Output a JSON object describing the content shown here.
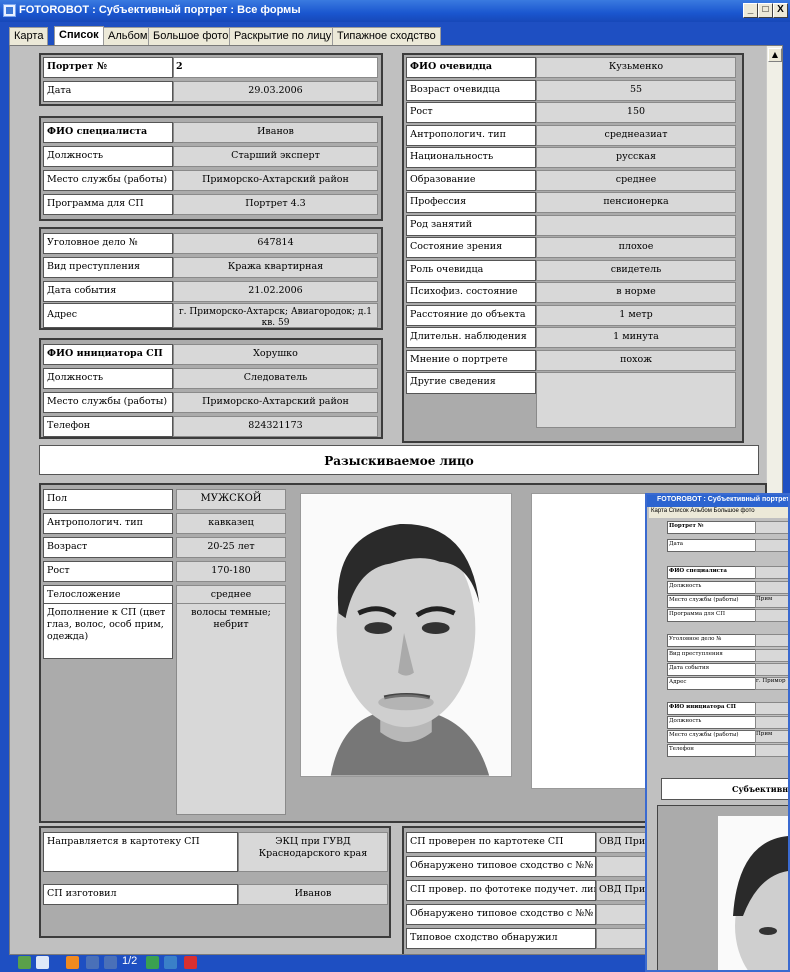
{
  "window": {
    "title": "FOTOROBOT : Субъективный портрет : Все формы",
    "minimize": "_",
    "maximize": "□",
    "close": "X"
  },
  "tabs": [
    "Карта",
    "Список",
    "Альбом",
    "Большое фото",
    "Раскрытие по лицу",
    "Типажное сходство"
  ],
  "portrait": {
    "number_label": "Портрет №",
    "number": "2",
    "date_label": "Дата",
    "date": "29.03.2006"
  },
  "specialist": [
    {
      "label": "ФИО специалиста",
      "value": "Иванов",
      "bold": true
    },
    {
      "label": "Должность",
      "value": "Старший эксперт"
    },
    {
      "label": "Место службы (работы)",
      "value": "Приморско-Ахтарский район"
    },
    {
      "label": "Программа для СП",
      "value": "Портрет 4.3"
    }
  ],
  "case": [
    {
      "label": "Уголовное дело №",
      "value": "647814"
    },
    {
      "label": "Вид преступления",
      "value": "Кража квартирная"
    },
    {
      "label": "Дата события",
      "value": "21.02.2006"
    },
    {
      "label": "Адрес",
      "value": "г. Приморско-Ахтарск; Авиагородок; д.1 кв. 59"
    }
  ],
  "initiator": [
    {
      "label": "ФИО инициатора СП",
      "value": "Хорушко",
      "bold": true
    },
    {
      "label": "Должность",
      "value": "Следователь"
    },
    {
      "label": "Место службы (работы)",
      "value": "Приморско-Ахтарский район"
    },
    {
      "label": "Телефон",
      "value": "824321173"
    }
  ],
  "witness": [
    {
      "label": "ФИО очевидца",
      "value": "Кузьменко",
      "bold": true
    },
    {
      "label": "Возраст очевидца",
      "value": "55"
    },
    {
      "label": "Рост",
      "value": "150"
    },
    {
      "label": "Антропологич. тип",
      "value": "среднеазиат"
    },
    {
      "label": "Национальность",
      "value": "русская"
    },
    {
      "label": "Образование",
      "value": "среднее"
    },
    {
      "label": "Профессия",
      "value": "пенсионерка"
    },
    {
      "label": "Род занятий",
      "value": ""
    },
    {
      "label": "Состояние зрения",
      "value": "плохое"
    },
    {
      "label": "Роль очевидца",
      "value": "свидетель"
    },
    {
      "label": "Психофиз. состояние",
      "value": "в норме"
    },
    {
      "label": "Расстояние до объекта",
      "value": "1 метр"
    },
    {
      "label": "Длительн. наблюдения",
      "value": "1 минута"
    },
    {
      "label": "Мнение о портрете",
      "value": "похож"
    },
    {
      "label": "Другие сведения",
      "value": ""
    }
  ],
  "section_title": "Разыскиваемое лицо",
  "suspect": [
    {
      "label": "Пол",
      "value": "МУЖСКОЙ"
    },
    {
      "label": "Антропологич. тип",
      "value": "кавказец"
    },
    {
      "label": "Возраст",
      "value": "20-25 лет"
    },
    {
      "label": "Рост",
      "value": "170-180"
    },
    {
      "label": "Телосложение",
      "value": "среднее"
    },
    {
      "label": "Дополнение к СП (цвет глаз, волос, особ прим, одежда)",
      "value": "волосы темные; небрит"
    }
  ],
  "routing": [
    {
      "label": "Направляется в картотеку СП",
      "value": "ЭКЦ при ГУВД Краснодарского края"
    },
    {
      "label": "СП изготовил",
      "value": "Иванов"
    }
  ],
  "checks": [
    {
      "label": "СП проверен по картотеке СП",
      "value": "ОВД При"
    },
    {
      "label": "Обнаружено типовое сходство с №№",
      "value": ""
    },
    {
      "label": "СП провер. по фототеке подучет. лиц",
      "value": "ОВД При"
    },
    {
      "label": "Обнаружено типовое сходство с №№",
      "value": ""
    },
    {
      "label": "Типовое сходство обнаружил",
      "value": ""
    }
  ],
  "nav": {
    "page": "1/2"
  },
  "subwindow": {
    "title": "FOTOROBOT : Субъективный портрет :",
    "tabs": "Карта  Список  Альбом  Большое фото",
    "rows": [
      "Портрет №",
      "Дата",
      "ФИО специалиста",
      "Должность",
      "Место службы (работы)",
      "Программа для СП",
      "Уголовное дело №",
      "Вид преступления",
      "Дата события",
      "Адрес",
      "ФИО инициатора СП",
      "Должность",
      "Место службы (работы)",
      "Телефон"
    ],
    "partial": [
      "Прим",
      "г. Примор",
      "Прим"
    ],
    "section": "Субъективны"
  },
  "colors": {
    "title_bar": "#1a56cf",
    "panel": "#ababab",
    "field": "#d8d8d8"
  }
}
